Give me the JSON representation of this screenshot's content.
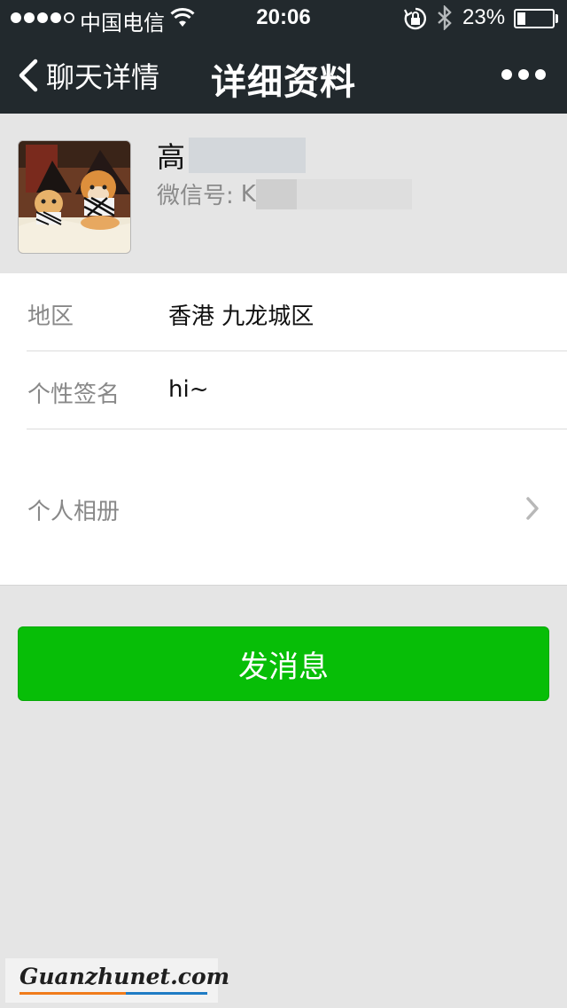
{
  "status_bar": {
    "carrier": "中国电信",
    "time": "20:06",
    "battery": "23%",
    "battery_level": 0.23,
    "signal_bars_filled": 4,
    "signal_bars_total": 5
  },
  "nav": {
    "back_label": "聊天详情",
    "title": "详细资料"
  },
  "profile": {
    "name_visible": "高",
    "wechat_id_label": "微信号:",
    "wechat_id_visible": "K"
  },
  "info_rows": [
    {
      "label": "地区",
      "value": "香港 九龙城区"
    },
    {
      "label": "个性签名",
      "value": "hi~"
    },
    {
      "label": "个人相册",
      "value": ""
    }
  ],
  "actions": {
    "send_message": "发消息"
  },
  "watermark": {
    "text": "Guanzhunet.com"
  },
  "colors": {
    "nav_bg": "#22292d",
    "page_bg": "#e5e5e5",
    "button_green": "#07be07",
    "label_gray": "#888888"
  }
}
